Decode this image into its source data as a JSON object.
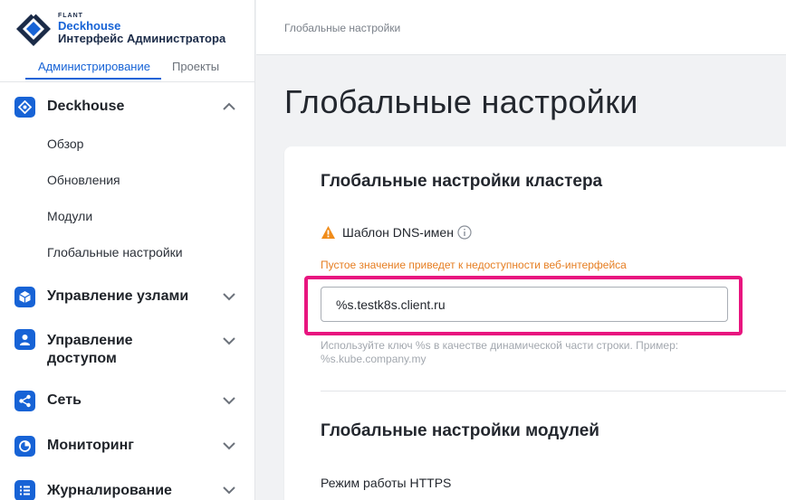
{
  "brand": {
    "flant": "FLANT",
    "product": "Deckhouse",
    "subtitle": "Интерфейс Администратора"
  },
  "tabs": [
    {
      "label": "Администрирование",
      "active": true
    },
    {
      "label": "Проекты",
      "active": false
    }
  ],
  "sidebar": {
    "groups": [
      {
        "label": "Deckhouse",
        "icon": "deckhouse-icon",
        "expanded": true,
        "items": [
          "Обзор",
          "Обновления",
          "Модули",
          "Глобальные настройки"
        ]
      },
      {
        "label": "Управление узлами",
        "icon": "cube-icon",
        "expanded": false
      },
      {
        "label_line1": "Управление",
        "label_line2": "доступом",
        "icon": "user-icon",
        "expanded": false
      },
      {
        "label": "Сеть",
        "icon": "share-icon",
        "expanded": false
      },
      {
        "label": "Мониторинг",
        "icon": "pie-chart-icon",
        "expanded": false
      },
      {
        "label": "Журналирование",
        "icon": "list-icon",
        "expanded": false
      }
    ]
  },
  "breadcrumb": "Глобальные настройки",
  "page_title": "Глобальные настройки",
  "card": {
    "cluster_section_title": "Глобальные настройки кластера",
    "dns_field": {
      "label": "Шаблон DNS-имен",
      "warning": "Пустое значение приведет к недоступности веб-интерфейса",
      "value": "%s.testk8s.client.ru",
      "hint": "Используйте ключ %s в качестве динамической части строки. Пример: %s.kube.company.my"
    },
    "modules_section_title": "Глобальные настройки модулей",
    "https_label": "Режим работы HTTPS"
  },
  "colors": {
    "accent": "#1763d6",
    "warning": "#e67e22",
    "highlight": "#e8157f"
  }
}
